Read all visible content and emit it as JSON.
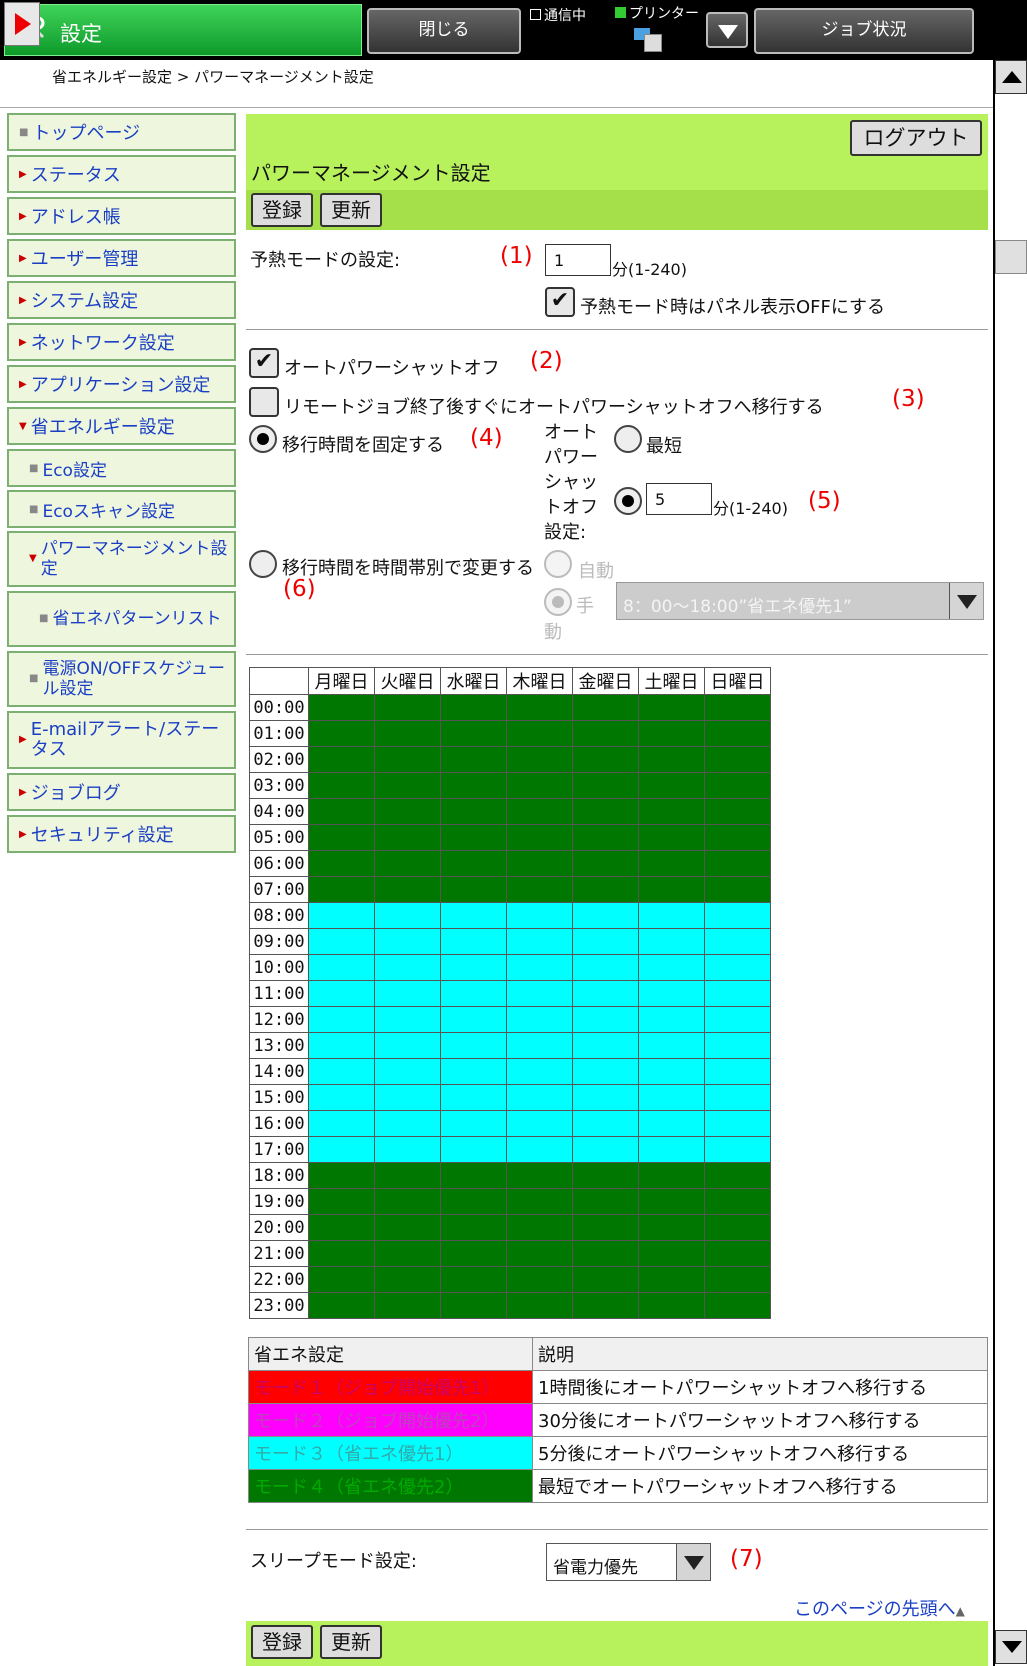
{
  "app": {
    "title": "設定",
    "close_label": "閉じる",
    "job_status_label": "ジョブ状況",
    "comm_label": "通信中",
    "printer_label": "プリンター"
  },
  "breadcrumb": "省エネルギー設定 > パワーマネージメント設定",
  "sidebar": {
    "items": [
      {
        "label": "トップページ"
      },
      {
        "label": "ステータス"
      },
      {
        "label": "アドレス帳"
      },
      {
        "label": "ユーザー管理"
      },
      {
        "label": "システム設定"
      },
      {
        "label": "ネットワーク設定"
      },
      {
        "label": "アプリケーション設定"
      },
      {
        "label": "省エネルギー設定"
      },
      {
        "label": "Eco設定"
      },
      {
        "label": "Ecoスキャン設定"
      },
      {
        "label": "パワーマネージメント設定"
      },
      {
        "label": "省エネパターンリスト"
      },
      {
        "label": "電源ON/OFFスケジュール設定"
      },
      {
        "label": "E-mailアラート/ステータス"
      },
      {
        "label": "ジョブログ"
      },
      {
        "label": "セキュリティ設定"
      }
    ]
  },
  "header": {
    "logout_label": "ログアウト",
    "page_title": "パワーマネージメント設定",
    "register_label": "登録",
    "update_label": "更新"
  },
  "preheat": {
    "label": "予熱モードの設定:",
    "marker": "(1)",
    "value": "1",
    "unit": "分(1-240)",
    "panel_off_label": "予熱モード時はパネル表示OFFにする"
  },
  "auto_power": {
    "label": "オートパワーシャットオフ",
    "marker": "(2)",
    "remote_label": "リモートジョブ終了後すぐにオートパワーシャットオフへ移行する",
    "remote_marker": "(3)",
    "fixed_label": "移行時間を固定する",
    "fixed_marker": "(4)",
    "setting_label": "オートパワーシャットオフ設定:",
    "shortest_label": "最短",
    "minutes_value": "5",
    "minutes_unit": "分(1-240)",
    "minutes_marker": "(5)",
    "timezone_label": "移行時間を時間帯別で変更する",
    "timezone_marker": "(6)",
    "auto_label": "自動",
    "manual_label": "手動",
    "pattern_value": "8：00～18:00”省エネ優先1”"
  },
  "schedule": {
    "days": [
      "月曜日",
      "火曜日",
      "水曜日",
      "木曜日",
      "金曜日",
      "土曜日",
      "日曜日"
    ],
    "hours": [
      "00:00",
      "01:00",
      "02:00",
      "03:00",
      "04:00",
      "05:00",
      "06:00",
      "07:00",
      "08:00",
      "09:00",
      "10:00",
      "11:00",
      "12:00",
      "13:00",
      "14:00",
      "15:00",
      "16:00",
      "17:00",
      "18:00",
      "19:00",
      "20:00",
      "21:00",
      "22:00",
      "23:00"
    ],
    "modes": [
      4,
      4,
      4,
      4,
      4,
      4,
      4,
      4,
      3,
      3,
      3,
      3,
      3,
      3,
      3,
      3,
      3,
      3,
      4,
      4,
      4,
      4,
      4,
      4
    ]
  },
  "legend": {
    "header_setting": "省エネ設定",
    "header_desc": "説明",
    "rows": [
      {
        "mode": "モード１（ジョブ開始優先1）",
        "desc": "1時間後にオートパワーシャットオフへ移行する",
        "color": "#ff0000"
      },
      {
        "mode": "モード２（ジョブ開始優先2）",
        "desc": "30分後にオートパワーシャットオフへ移行する",
        "color": "#ff00ff"
      },
      {
        "mode": "モード３（省エネ優先1）",
        "desc": "5分後にオートパワーシャットオフへ移行する",
        "color": "#00ffff"
      },
      {
        "mode": "モード４（省エネ優先2）",
        "desc": "最短でオートパワーシャットオフへ移行する",
        "color": "#007700"
      }
    ]
  },
  "sleep": {
    "label": "スリープモード設定:",
    "value": "省電力優先",
    "marker": "(7)"
  },
  "top_link": "このページの先頭へ"
}
